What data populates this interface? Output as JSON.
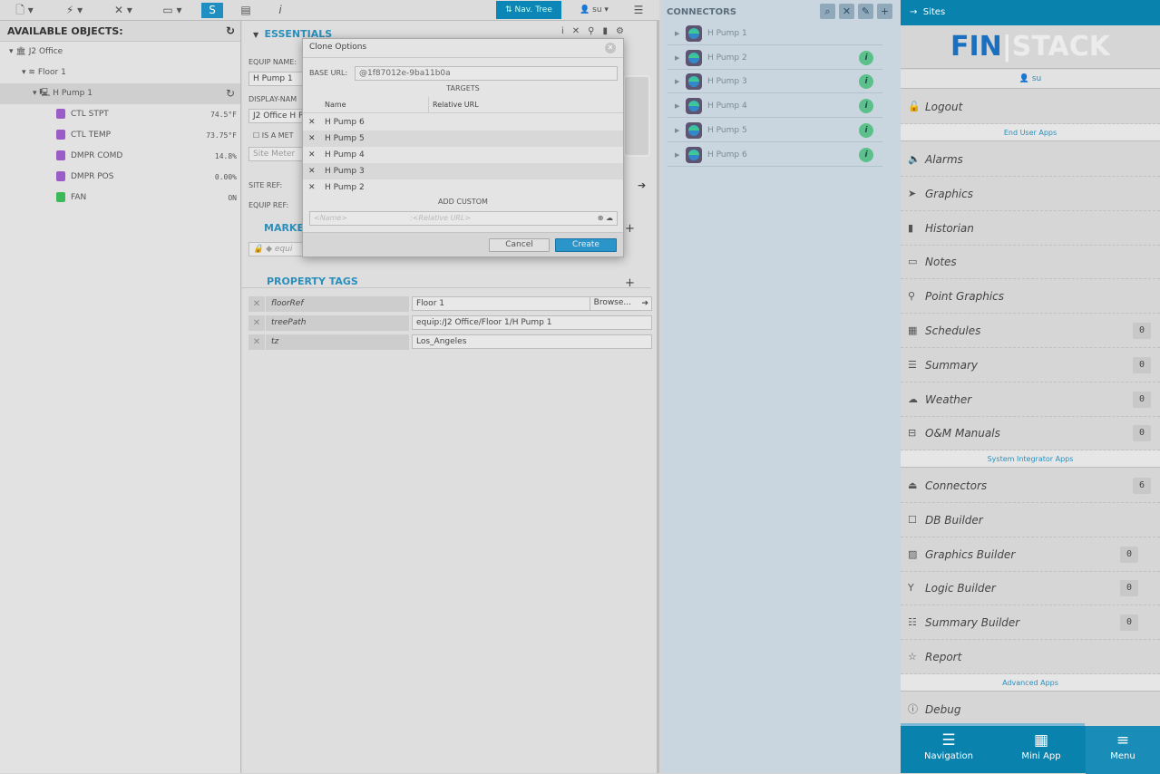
{
  "toolbar": {
    "nav_tree": "Nav. Tree",
    "user": "su",
    "icons": [
      "new-document-icon",
      "lightning-icon",
      "tools-icon",
      "window-icon",
      "sync-icon",
      "notes-icon",
      "info-icon",
      "menu-icon"
    ]
  },
  "left": {
    "title": "AVAILABLE OBJECTS:",
    "tree": [
      {
        "label": "J2 Office",
        "icon": "building-icon"
      },
      {
        "label": "Floor 1",
        "icon": "layers-icon"
      },
      {
        "label": "H Pump 1",
        "icon": "equip-icon"
      }
    ],
    "points": [
      {
        "label": "CTL STPT",
        "value": "74.5°F",
        "color": "#9a5cc6"
      },
      {
        "label": "CTL TEMP",
        "value": "73.75°F",
        "color": "#9a5cc6"
      },
      {
        "label": "DMPR COMD",
        "value": "14.8%",
        "color": "#9a5cc6"
      },
      {
        "label": "DMPR POS",
        "value": "0.00%",
        "color": "#9a5cc6"
      },
      {
        "label": "FAN",
        "value": "ON",
        "color": "#3cba5a"
      }
    ]
  },
  "mid": {
    "essentials": "ESSENTIALS",
    "equip_name_label": "EQUIP NAME:",
    "equip_name": "H Pump 1",
    "display_name_label": "DISPLAY-NAM",
    "display_name": "J2 Office H P",
    "is_meter": "IS A MET",
    "site_meter": "Site Meter",
    "site_ref": "SITE REF:",
    "equip_ref": "EQUIP REF:",
    "markers": "MARKE",
    "marker_tag": "equi",
    "property_tags": "PROPERTY TAGS",
    "props": [
      {
        "name": "floorRef",
        "value": "Floor 1",
        "browse": "Browse..."
      },
      {
        "name": "treePath",
        "value": "equip:/J2 Office/Floor 1/H Pump 1"
      },
      {
        "name": "tz",
        "value": "Los_Angeles"
      }
    ]
  },
  "modal": {
    "title": "Clone Options",
    "base_url_label": "BASE URL:",
    "base_url": "@1f87012e-9ba11b0a",
    "targets": "TARGETS",
    "col_name": "Name",
    "col_url": "Relative URL",
    "rows": [
      "H Pump 6",
      "H Pump 5",
      "H Pump 4",
      "H Pump 3",
      "H Pump 2"
    ],
    "add_custom": "ADD CUSTOM",
    "name_ph": "<Name>",
    "url_ph": ":<Relative URL>",
    "cancel": "Cancel",
    "create": "Create"
  },
  "connectors": {
    "title": "CONNECTORS",
    "items": [
      {
        "label": "H Pump 1",
        "info": false
      },
      {
        "label": "H Pump 2",
        "info": true
      },
      {
        "label": "H Pump 3",
        "info": true
      },
      {
        "label": "H Pump 4",
        "info": true
      },
      {
        "label": "H Pump 5",
        "info": true
      },
      {
        "label": "H Pump 6",
        "info": true
      }
    ]
  },
  "menu": {
    "sites": "Sites",
    "logo_a": "FIN",
    "logo_b": "STACK",
    "user": "su",
    "logout": "Logout",
    "end_user": "End User Apps",
    "end_items": [
      {
        "label": "Alarms",
        "icon": "🔈"
      },
      {
        "label": "Graphics",
        "icon": "➤"
      },
      {
        "label": "Historian",
        "icon": "▮"
      },
      {
        "label": "Notes",
        "icon": "▭"
      },
      {
        "label": "Point Graphics",
        "icon": "⚲"
      },
      {
        "label": "Schedules",
        "icon": "▦",
        "badge": "0"
      },
      {
        "label": "Summary",
        "icon": "☰",
        "badge": "0"
      },
      {
        "label": "Weather",
        "icon": "☁",
        "badge": "0"
      },
      {
        "label": "O&M Manuals",
        "icon": "⊟",
        "badge": "0"
      }
    ],
    "si": "System Integrator Apps",
    "si_items": [
      {
        "label": "Connectors",
        "icon": "⏏",
        "badge": "6"
      },
      {
        "label": "DB Builder",
        "icon": "☐"
      },
      {
        "label": "Graphics Builder",
        "icon": "▨",
        "badge": "0"
      },
      {
        "label": "Logic Builder",
        "icon": "Y",
        "badge": "0"
      },
      {
        "label": "Summary Builder",
        "icon": "☷",
        "badge": "0"
      },
      {
        "label": "Report",
        "icon": "☆"
      }
    ],
    "adv": "Advanced Apps",
    "debug": "Debug",
    "nav": [
      {
        "label": "Navigation",
        "icon": "☰"
      },
      {
        "label": "Mini App",
        "icon": "▦"
      },
      {
        "label": "Menu",
        "icon": "≡"
      }
    ],
    "accent": "#0a82ae"
  }
}
